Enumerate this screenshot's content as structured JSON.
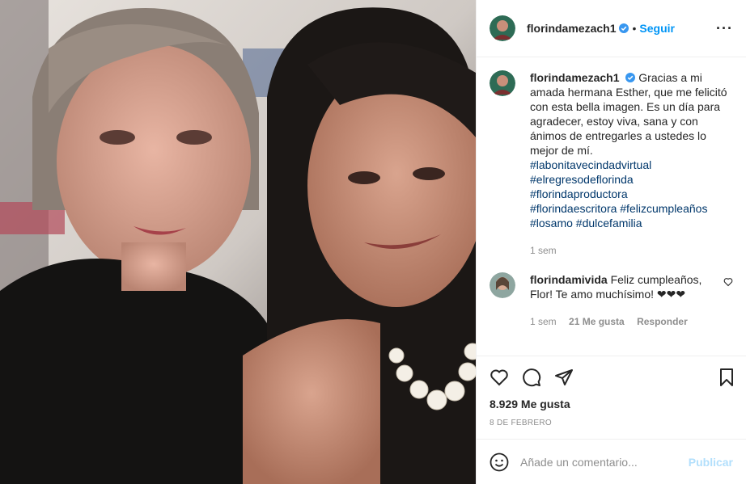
{
  "post": {
    "username": "florindamezach1",
    "follow_label": "Seguir",
    "dot": "•",
    "more": "···",
    "caption": {
      "text": "Gracias a mi amada hermana Esther, que me felicitó con esta bella imagen. Es un día para agradecer, estoy viva, sana y con ánimos de entregarles a ustedes lo mejor de mí.",
      "hashtags": [
        "#labonitavecindadvirtual",
        "#elregresodeflorinda",
        "#florindaproductora",
        "#florindaescritora #felizcumpleaños",
        "#losamo #dulcefamilia"
      ],
      "time": "1 sem"
    },
    "comment": {
      "username": "florindamivida",
      "text": "Feliz cumpleaños, Flor! Te amo muchísimo! ❤❤❤",
      "time": "1 sem",
      "likes": "21 Me gusta",
      "reply": "Responder"
    },
    "likes": "8.929 Me gusta",
    "date": "8 DE FEBRERO",
    "add_comment": {
      "placeholder": "Añade un comentario...",
      "publish": "Publicar"
    },
    "colors": {
      "accent": "#0095f6",
      "link": "#00376b",
      "muted": "#8e8e8e",
      "publish_disabled": "#b2dffc"
    }
  }
}
